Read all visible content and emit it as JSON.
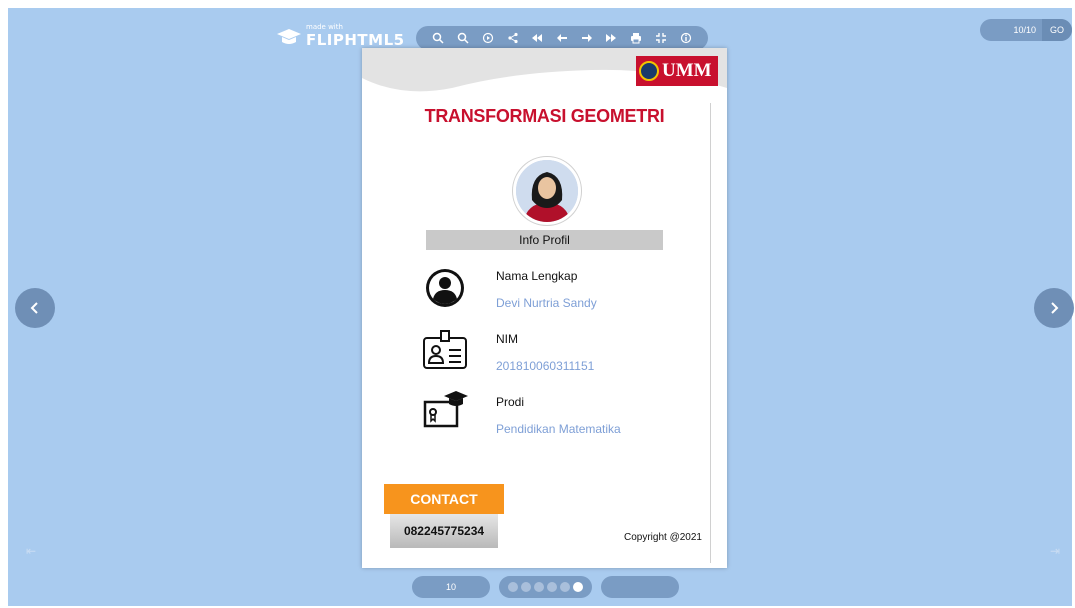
{
  "brand": {
    "made_with": "made with",
    "name": "FLIPHTML5"
  },
  "toolbar": {
    "buttons": [
      "zoom-in-icon",
      "zoom-out-icon",
      "autoplay-icon",
      "share-icon",
      "first-page-icon",
      "previous-page-icon",
      "next-page-icon",
      "last-page-icon",
      "print-icon",
      "fullscreen-icon",
      "info-icon"
    ]
  },
  "page_nav": {
    "current": "10/10",
    "go_label": "GO"
  },
  "document": {
    "logo_text": "UMM",
    "title": "TRANSFORMASI GEOMETRI",
    "profile_header": "Info Profil",
    "fields": [
      {
        "label": "Nama Lengkap",
        "value": "Devi Nurtria Sandy"
      },
      {
        "label": "NIM",
        "value": "201810060311151"
      },
      {
        "label": "Prodi",
        "value": "Pendidikan Matematika"
      }
    ],
    "contact_label": "CONTACT",
    "phone": "082245775234",
    "copyright": "Copyright @2021"
  },
  "bottom": {
    "page_number": "10",
    "dots_total": 6,
    "dots_active_index": 5
  },
  "colors": {
    "viewer_bg": "#a9cbef",
    "title": "#c8102e",
    "contact": "#f7941d",
    "field_value": "#7e9fd6"
  }
}
